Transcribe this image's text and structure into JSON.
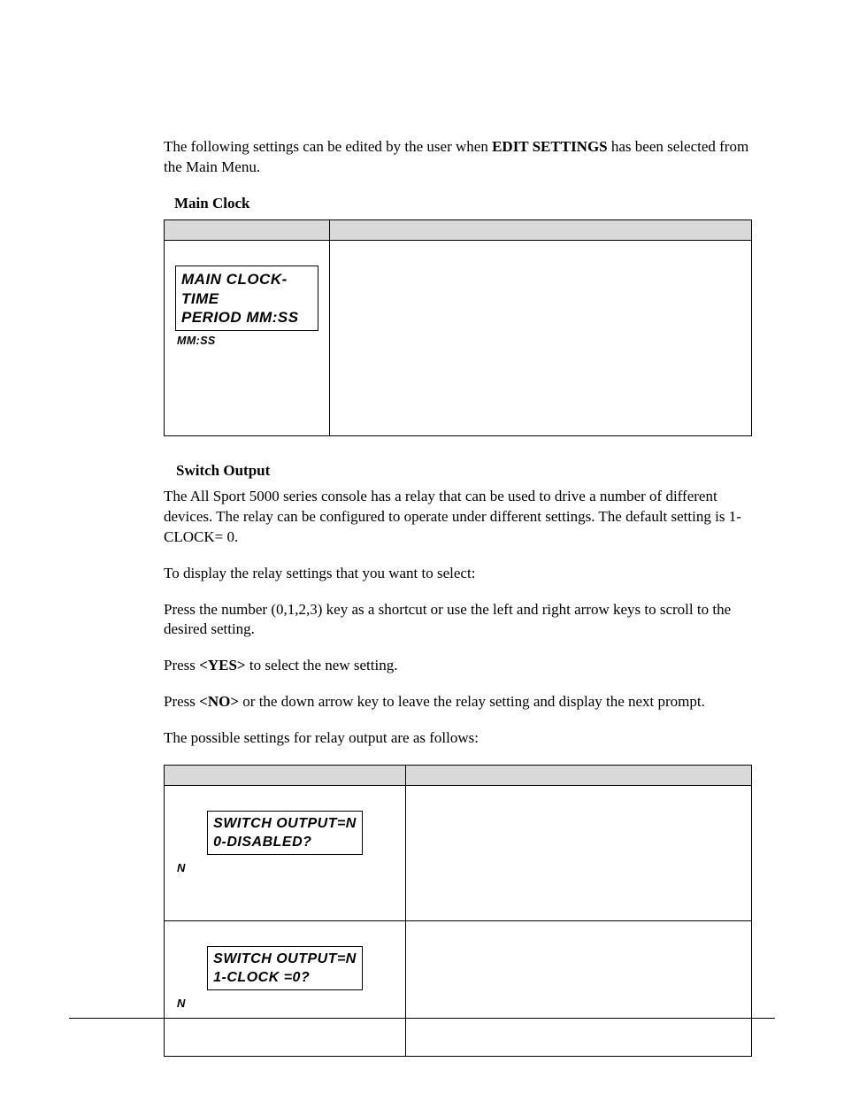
{
  "intro": {
    "prefix": "The following settings can be edited by the user when ",
    "bold": "EDIT SETTINGS",
    "suffix": " has been selected from the Main Menu."
  },
  "mainClock": {
    "heading": "Main Clock",
    "table": {
      "headLeft": "",
      "headRight": "",
      "lcdLine1": "MAIN CLOCK-TIME",
      "lcdLine2": "PERIOD   MM:SS",
      "subLabel": "MM:SS",
      "rightCell": ""
    }
  },
  "switchOutput": {
    "heading": "Switch Output",
    "p1": "The All Sport 5000 series console has a relay that can be used to drive a number of different devices.  The relay can be configured to operate under different settings. The default setting is 1-CLOCK= 0.",
    "p2": "To display the relay settings that you want to select:",
    "p3": "Press the number (0,1,2,3) key as a shortcut or use the left and right arrow keys to scroll to the desired setting.",
    "p4a": "Press ",
    "p4yes": "<YES>",
    "p4b": " to select the new setting.",
    "p5a": "Press ",
    "p5no": "<NO>",
    "p5b": " or the down arrow key to leave the relay setting and display the next prompt.",
    "p6": "The possible settings for relay output are as follows:",
    "table": {
      "headLeft": "",
      "headRight": "",
      "rows": [
        {
          "lcdLine1": "SWITCH OUTPUT=N",
          "lcdLine2": "0-DISABLED?",
          "nLabel": "N",
          "right": ""
        },
        {
          "lcdLine1": "SWITCH OUTPUT=N",
          "lcdLine2": "1-CLOCK =0?",
          "nLabel": "N",
          "right": ""
        }
      ]
    }
  }
}
